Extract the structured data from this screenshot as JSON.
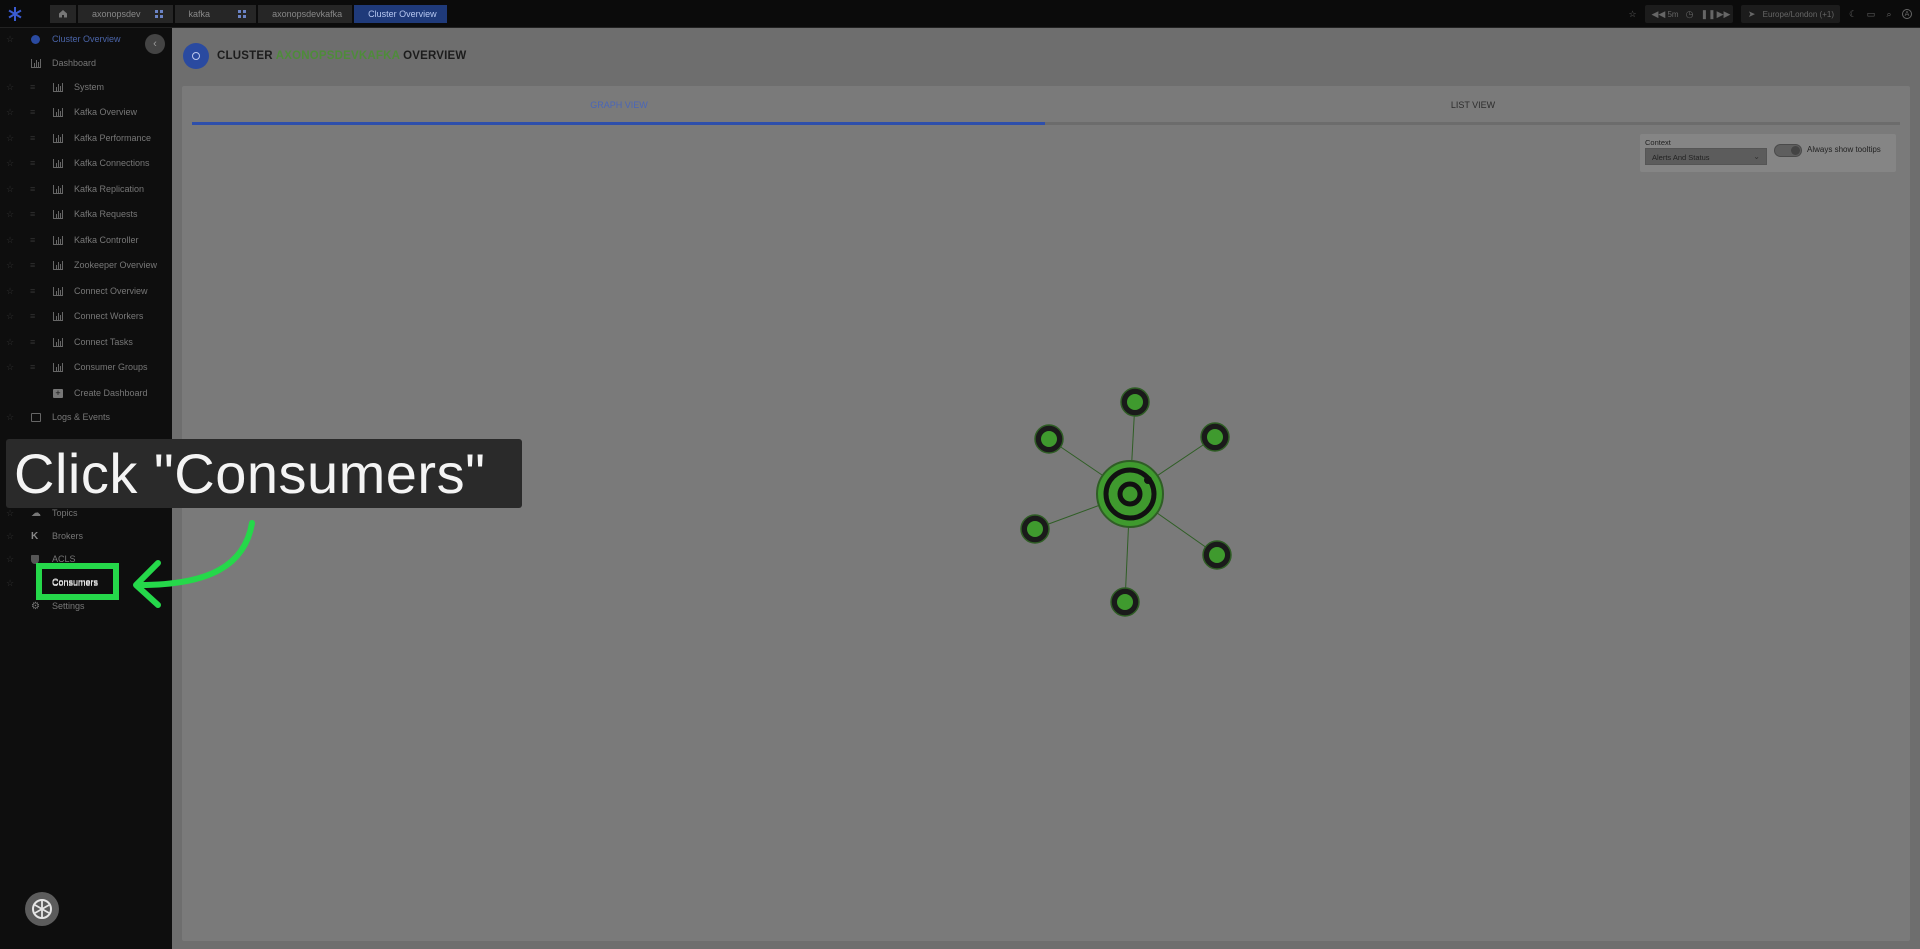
{
  "topbar": {
    "breadcrumbs": [
      {
        "label": "axonopsdev"
      },
      {
        "label": "kafka"
      },
      {
        "label": "axonopsdevkafka"
      },
      {
        "label": "Cluster Overview"
      }
    ],
    "time_range": "5m",
    "timezone": "Europe/London (+1)"
  },
  "sidebar": {
    "items": [
      {
        "label": "Cluster Overview",
        "selected": true
      },
      {
        "label": "Dashboard"
      },
      {
        "label": "System"
      },
      {
        "label": "Kafka Overview"
      },
      {
        "label": "Kafka Performance"
      },
      {
        "label": "Kafka Connections"
      },
      {
        "label": "Kafka Replication"
      },
      {
        "label": "Kafka Requests"
      },
      {
        "label": "Kafka Controller"
      },
      {
        "label": "Zookeeper Overview"
      },
      {
        "label": "Connect Overview"
      },
      {
        "label": "Connect Workers"
      },
      {
        "label": "Connect Tasks"
      },
      {
        "label": "Consumer Groups"
      },
      {
        "label": "Create Dashboard"
      },
      {
        "label": "Logs & Events"
      },
      {
        "label": "Topics"
      },
      {
        "label": "Brokers"
      },
      {
        "label": "ACLS"
      },
      {
        "label": "Consumers"
      },
      {
        "label": "Settings"
      }
    ]
  },
  "main": {
    "title_prefix": "CLUSTER",
    "title_cluster": "AXONOPSDEVKAFKA",
    "title_suffix": "OVERVIEW",
    "tabs": [
      {
        "label": "GRAPH VIEW",
        "active": true
      },
      {
        "label": "LIST VIEW"
      }
    ],
    "context_label": "Context",
    "context_value": "Alerts And Status",
    "tooltip_toggle_label": "Always show tooltips"
  },
  "overlay": {
    "instruction": "Click \"Consumers\"",
    "target_label": "Consumers"
  },
  "colors": {
    "accent": "#2e4fab",
    "highlight": "#25d84a",
    "node_fill": "#3f9a2e",
    "cluster_name": "#4e8c3a"
  }
}
